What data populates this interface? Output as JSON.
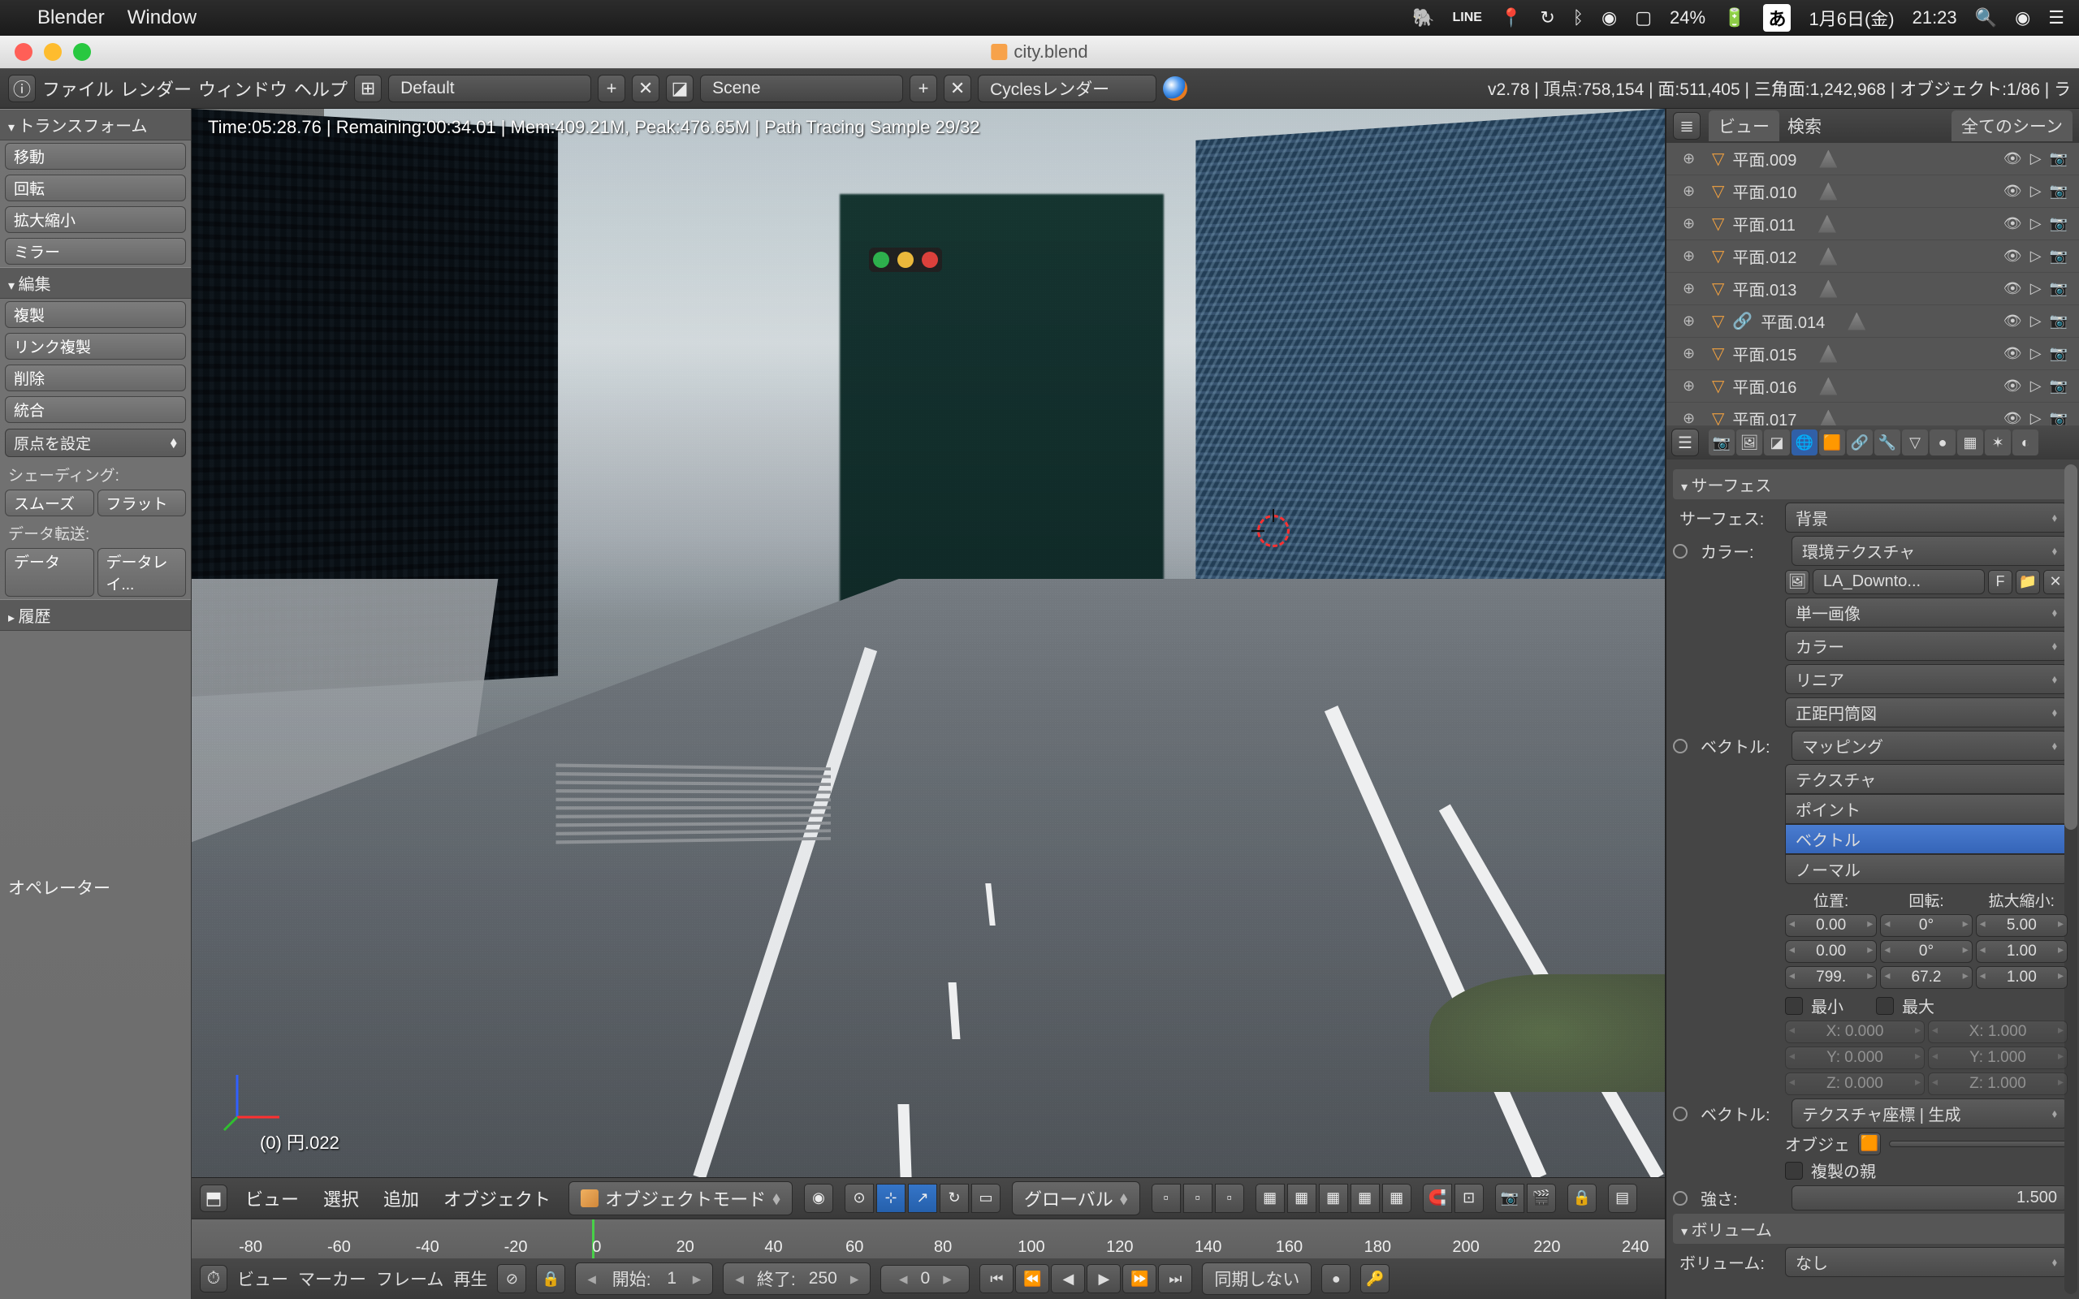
{
  "mac_menubar": {
    "app": "Blender",
    "menu_window": "Window",
    "battery": "24%",
    "ime": "あ",
    "date": "1月6日(金)",
    "time": "21:23"
  },
  "window": {
    "title": "city.blend"
  },
  "info_header": {
    "layout": "Default",
    "scene": "Scene",
    "engine": "Cyclesレンダー",
    "version": "v2.78",
    "verts_label": "頂点:",
    "verts": "758,154",
    "faces_label": "面:",
    "faces": "511,405",
    "tris_label": "三角面:",
    "tris": "1,242,968",
    "objects_label": "オブジェクト:",
    "objects": "1/86",
    "lamps_suffix": "ラ"
  },
  "left_panel": {
    "transform": "トランスフォーム",
    "move": "移動",
    "rotate": "回転",
    "scale": "拡大縮小",
    "mirror": "ミラー",
    "edit": "編集",
    "duplicate": "複製",
    "link_dup": "リンク複製",
    "delete": "削除",
    "join": "統合",
    "set_origin": "原点を設定",
    "shading_label": "シェーディング:",
    "smooth": "スムーズ",
    "flat": "フラット",
    "data_transfer_label": "データ転送:",
    "data": "データ",
    "data_layout": "データレイ...",
    "history": "履歴",
    "operator": "オペレーター"
  },
  "viewport": {
    "render_status": "Time:05:28.76 | Remaining:00:34.01 | Mem:409.21M, Peak:476.65M | Path Tracing Sample 29/32",
    "object_label": "(0) 円.022"
  },
  "vp_footer": {
    "view": "ビュー",
    "select": "選択",
    "add": "追加",
    "object": "オブジェクト",
    "mode": "オブジェクトモード",
    "orientation": "グローバル"
  },
  "timeline": {
    "ticks": [
      "-80",
      "-60",
      "-40",
      "-20",
      "0",
      "20",
      "40",
      "60",
      "80",
      "100",
      "120",
      "140",
      "160",
      "180",
      "200",
      "220",
      "240"
    ],
    "menus": {
      "view": "ビュー",
      "marker": "マーカー",
      "frame": "フレーム",
      "playback": "再生"
    },
    "start_label": "開始:",
    "start_val": "1",
    "end_label": "終了:",
    "end_val": "250",
    "current": "0",
    "sync": "同期しない"
  },
  "outliner": {
    "tab_view": "ビュー",
    "tab_search": "検索",
    "tab_allscenes": "全てのシーン",
    "items": [
      "平面.009",
      "平面.010",
      "平面.011",
      "平面.012",
      "平面.013",
      "平面.014",
      "平面.015",
      "平面.016",
      "平面.017"
    ]
  },
  "properties": {
    "surface_hdr": "サーフェス",
    "surface_label": "サーフェス:",
    "surface_val": "背景",
    "color_label": "カラー:",
    "color_val": "環境テクスチャ",
    "image_name": "LA_Downto...",
    "image_f": "F",
    "img_mode": "単一画像",
    "colorspace": "カラー",
    "linear": "リニア",
    "projection": "正距円筒図",
    "vector_label": "ベクトル:",
    "mapping": "マッピング",
    "texture": "テクスチャ",
    "point": "ポイント",
    "vector_opt": "ベクトル",
    "normal": "ノーマル",
    "loc_label": "位置:",
    "rot_label": "回転:",
    "scl_label": "拡大縮小:",
    "loc": [
      "0.00",
      "0.00",
      "799."
    ],
    "rot": [
      "0°",
      "0°",
      "67.2"
    ],
    "scl": [
      "5.00",
      "1.00",
      "1.00"
    ],
    "min_label": "最小",
    "max_label": "最大",
    "min": {
      "x": "X:   0.000",
      "y": "Y:   0.000",
      "z": "Z:   0.000"
    },
    "max": {
      "x": "X:   1.000",
      "y": "Y:   1.000",
      "z": "Z:   1.000"
    },
    "texcoord": "テクスチャ座標 | 生成",
    "obj_label": "オブジェ",
    "dup_parent": "複製の親",
    "strength_label": "強さ:",
    "strength_val": "1.500",
    "volume_hdr": "ボリューム",
    "volume_label": "ボリューム:",
    "volume_val": "なし"
  }
}
